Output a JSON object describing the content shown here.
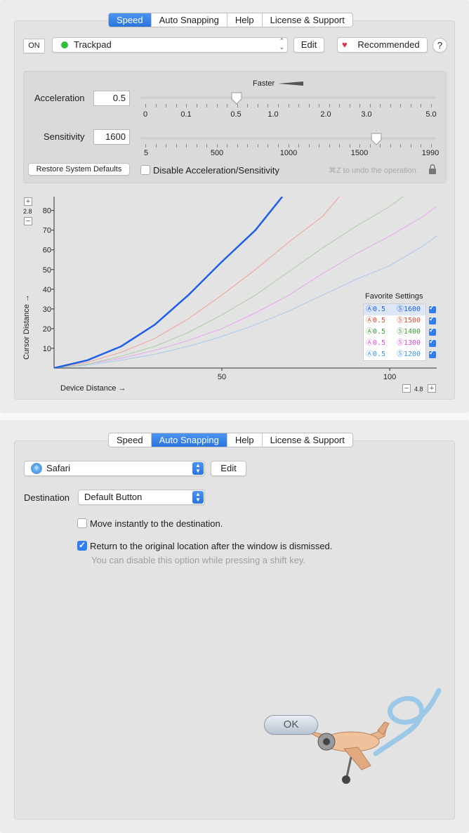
{
  "speed_window": {
    "tabs": [
      "Speed",
      "Auto Snapping",
      "Help",
      "License & Support"
    ],
    "active_tab": "Speed",
    "on_button": "ON",
    "device": {
      "label": "Trackpad",
      "status_color": "#2fbf3c"
    },
    "edit_label": "Edit",
    "recommended_label": "Recommended",
    "help_label": "?",
    "faster_label": "Faster",
    "acceleration": {
      "label": "Acceleration",
      "value": "0.5",
      "ticks": [
        "0",
        "0.1",
        "0.5",
        "1.0",
        "2.0",
        "3.0",
        "5.0"
      ],
      "level": 0.325
    },
    "sensitivity": {
      "label": "Sensitivity",
      "value": "1600",
      "ticks": [
        "5",
        "500",
        "1000",
        "1500",
        "1990"
      ],
      "level": 0.8
    },
    "restore_label": "Restore System Defaults",
    "disable_label": "Disable Acceleration/Sensitivity",
    "undo_hint": "⌘Z to undo the operation."
  },
  "chart": {
    "y_zoom": "2.8",
    "x_zoom": "4.8",
    "plus": "+",
    "minus": "−",
    "favorites_title": "Favorite Settings",
    "favorites": [
      {
        "accel": "Ⓐ0.5",
        "sens": "Ⓢ1600",
        "color": "#1f5fe8"
      },
      {
        "accel": "Ⓐ0.5",
        "sens": "Ⓢ1500",
        "color": "#e04a3a"
      },
      {
        "accel": "Ⓐ0.5",
        "sens": "Ⓢ1400",
        "color": "#3c9a3c"
      },
      {
        "accel": "Ⓐ0.5",
        "sens": "Ⓢ1300",
        "color": "#d34fd8"
      },
      {
        "accel": "Ⓐ0.5",
        "sens": "Ⓢ1200",
        "color": "#3f94e0"
      }
    ]
  },
  "chart_data": {
    "type": "line",
    "xlabel": "Device Distance →",
    "ylabel": "Cursor Distance →",
    "xlim": [
      0,
      114
    ],
    "ylim": [
      0,
      87
    ],
    "x_ticks": [
      50,
      100
    ],
    "y_ticks": [
      10,
      20,
      30,
      40,
      50,
      60,
      70,
      80
    ],
    "series": [
      {
        "name": "Ⓐ0.5 Ⓢ1600",
        "color": "#1f5fe8",
        "width": 2.5,
        "points": [
          [
            0,
            0
          ],
          [
            10,
            4
          ],
          [
            20,
            11
          ],
          [
            30,
            22
          ],
          [
            40,
            37
          ],
          [
            50,
            54
          ],
          [
            60,
            70
          ],
          [
            68,
            87
          ]
        ]
      },
      {
        "name": "Ⓐ0.5 Ⓢ1500",
        "color": "#f0a494",
        "width": 1,
        "points": [
          [
            0,
            0
          ],
          [
            10,
            3
          ],
          [
            20,
            8
          ],
          [
            30,
            15
          ],
          [
            40,
            25
          ],
          [
            50,
            37
          ],
          [
            60,
            50
          ],
          [
            70,
            64
          ],
          [
            80,
            77
          ],
          [
            85,
            87
          ]
        ]
      },
      {
        "name": "Ⓐ0.5 Ⓢ1400",
        "color": "#a9cfa0",
        "width": 1,
        "points": [
          [
            0,
            0
          ],
          [
            10,
            2
          ],
          [
            20,
            6
          ],
          [
            30,
            11
          ],
          [
            40,
            18
          ],
          [
            50,
            27
          ],
          [
            60,
            37
          ],
          [
            70,
            49
          ],
          [
            80,
            61
          ],
          [
            90,
            72
          ],
          [
            100,
            82
          ],
          [
            104,
            87
          ]
        ]
      },
      {
        "name": "Ⓐ0.5 Ⓢ1300",
        "color": "#e6a6ee",
        "width": 1,
        "points": [
          [
            0,
            0
          ],
          [
            10,
            2
          ],
          [
            20,
            5
          ],
          [
            30,
            9
          ],
          [
            40,
            14
          ],
          [
            50,
            20
          ],
          [
            60,
            28
          ],
          [
            70,
            37
          ],
          [
            80,
            48
          ],
          [
            90,
            58
          ],
          [
            100,
            67
          ],
          [
            110,
            77
          ],
          [
            114,
            82
          ]
        ]
      },
      {
        "name": "Ⓐ0.5 Ⓢ1200",
        "color": "#a8c8ec",
        "width": 1,
        "points": [
          [
            0,
            0
          ],
          [
            10,
            1.5
          ],
          [
            20,
            4
          ],
          [
            30,
            7
          ],
          [
            40,
            11
          ],
          [
            50,
            16
          ],
          [
            60,
            22
          ],
          [
            70,
            29
          ],
          [
            80,
            37
          ],
          [
            90,
            45
          ],
          [
            100,
            52
          ],
          [
            110,
            62
          ],
          [
            114,
            67
          ]
        ]
      }
    ]
  },
  "snap_window": {
    "tabs": [
      "Speed",
      "Auto Snapping",
      "Help",
      "License & Support"
    ],
    "active_tab": "Auto Snapping",
    "app": {
      "label": "Safari"
    },
    "edit_label": "Edit",
    "destination_label": "Destination",
    "destination_value": "Default Button",
    "move_instantly": {
      "label": "Move instantly to the destination.",
      "checked": false
    },
    "return_original": {
      "label": "Return to the original location after the window is dismissed.",
      "checked": true
    },
    "hint": "You can disable this option while pressing a shift key.",
    "ok_label": "OK"
  }
}
